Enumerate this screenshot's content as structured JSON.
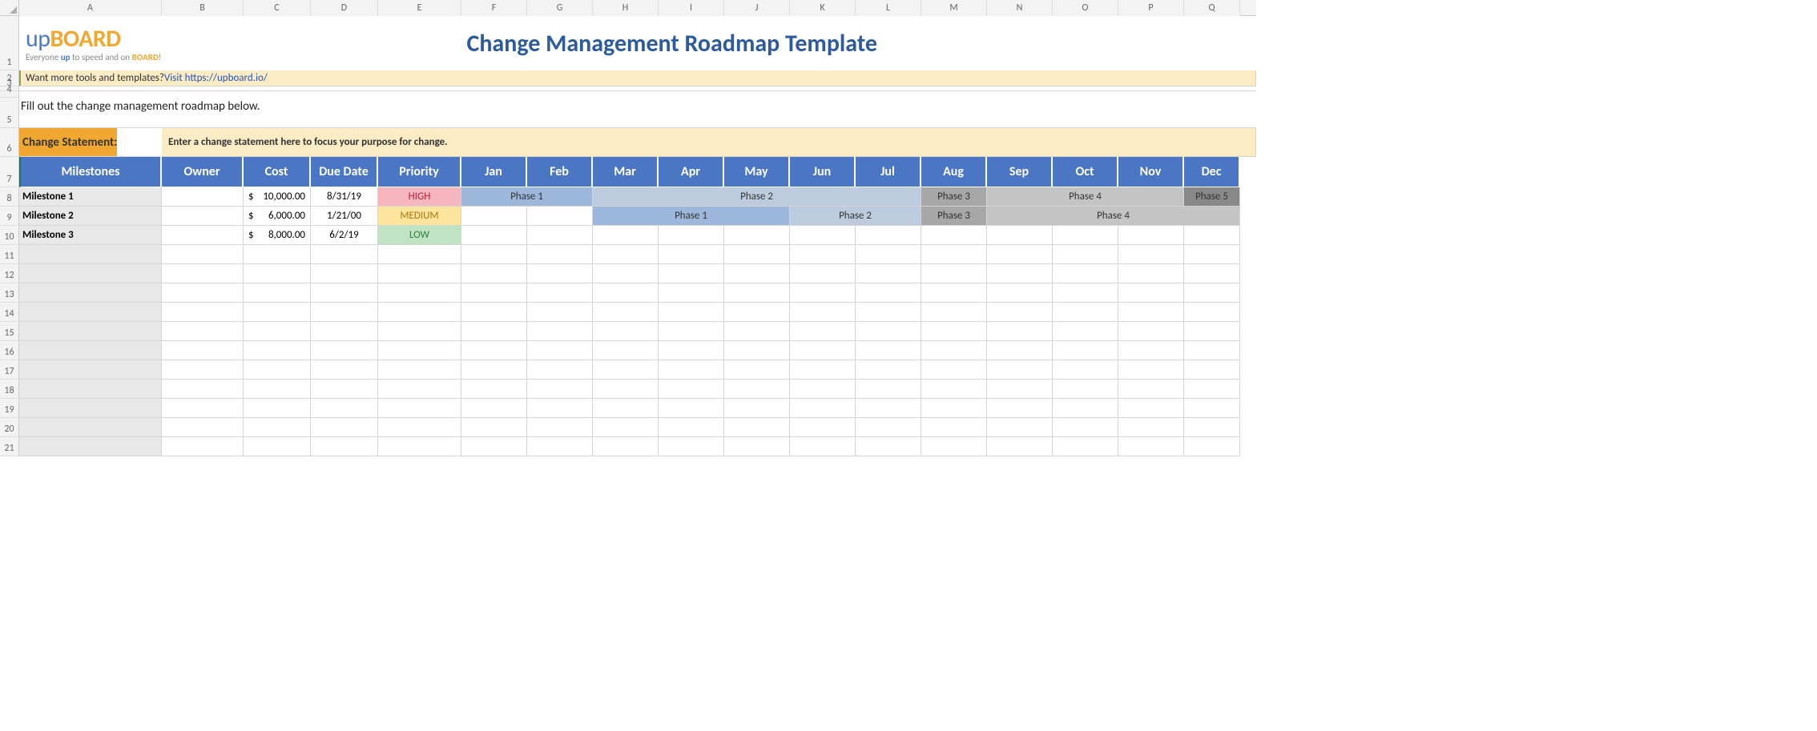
{
  "columns": [
    "A",
    "B",
    "C",
    "D",
    "E",
    "F",
    "G",
    "H",
    "I",
    "J",
    "K",
    "L",
    "M",
    "N",
    "O",
    "P",
    "Q"
  ],
  "row_numbers": [
    "1",
    "2",
    "3",
    "4",
    "5",
    "6",
    "7",
    "8",
    "9",
    "10",
    "11",
    "12",
    "13",
    "14",
    "15",
    "16",
    "17",
    "18",
    "19",
    "20",
    "21"
  ],
  "logo": {
    "up": "up",
    "board": "BOARD",
    "tag_pre": "Everyone ",
    "tag_up": "up",
    "tag_mid": " to speed and on ",
    "tag_board": "BOARD",
    "tag_post": "!"
  },
  "title": "Change Management Roadmap Template",
  "info": {
    "text": "Want more tools and templates? ",
    "link_label": "Visit https://upboard.io/"
  },
  "instruction": "Fill out the change management roadmap below.",
  "change_statement": {
    "label": "Change Statement:",
    "placeholder": "Enter a change statement here to focus your purpose for change."
  },
  "headers": {
    "milestones": "Milestones",
    "owner": "Owner",
    "cost": "Cost",
    "due": "Due Date",
    "priority": "Priority",
    "months": [
      "Jan",
      "Feb",
      "Mar",
      "Apr",
      "May",
      "Jun",
      "Jul",
      "Aug",
      "Sep",
      "Oct",
      "Nov",
      "Dec"
    ]
  },
  "milestones": [
    {
      "name": "Milestone 1",
      "owner": "",
      "currency": "$",
      "cost": "10,000.00",
      "due": "8/31/19",
      "priority": "HIGH",
      "phases": [
        {
          "label": "Phase 1",
          "start": 0,
          "span": 2,
          "cls": "ph1"
        },
        {
          "label": "Phase 2",
          "start": 2,
          "span": 5,
          "cls": "ph2"
        },
        {
          "label": "Phase 3",
          "start": 7,
          "span": 1,
          "cls": "ph3"
        },
        {
          "label": "Phase 4",
          "start": 8,
          "span": 3,
          "cls": "ph4"
        },
        {
          "label": "Phase 5",
          "start": 11,
          "span": 1,
          "cls": "ph5"
        }
      ]
    },
    {
      "name": "Milestone 2",
      "owner": "",
      "currency": "$",
      "cost": "6,000.00",
      "due": "1/21/00",
      "priority": "MEDIUM",
      "phases": [
        {
          "label": "Phase 1",
          "start": 2,
          "span": 3,
          "cls": "ph1"
        },
        {
          "label": "Phase 2",
          "start": 5,
          "span": 2,
          "cls": "ph2"
        },
        {
          "label": "Phase 3",
          "start": 7,
          "span": 1,
          "cls": "ph3"
        },
        {
          "label": "Phase 4",
          "start": 8,
          "span": 4,
          "cls": "ph4"
        }
      ]
    },
    {
      "name": "Milestone 3",
      "owner": "",
      "currency": "$",
      "cost": "8,000.00",
      "due": "6/2/19",
      "priority": "LOW",
      "phases": []
    }
  ],
  "priority_class": {
    "HIGH": "prio-high",
    "MEDIUM": "prio-med",
    "LOW": "prio-low"
  }
}
